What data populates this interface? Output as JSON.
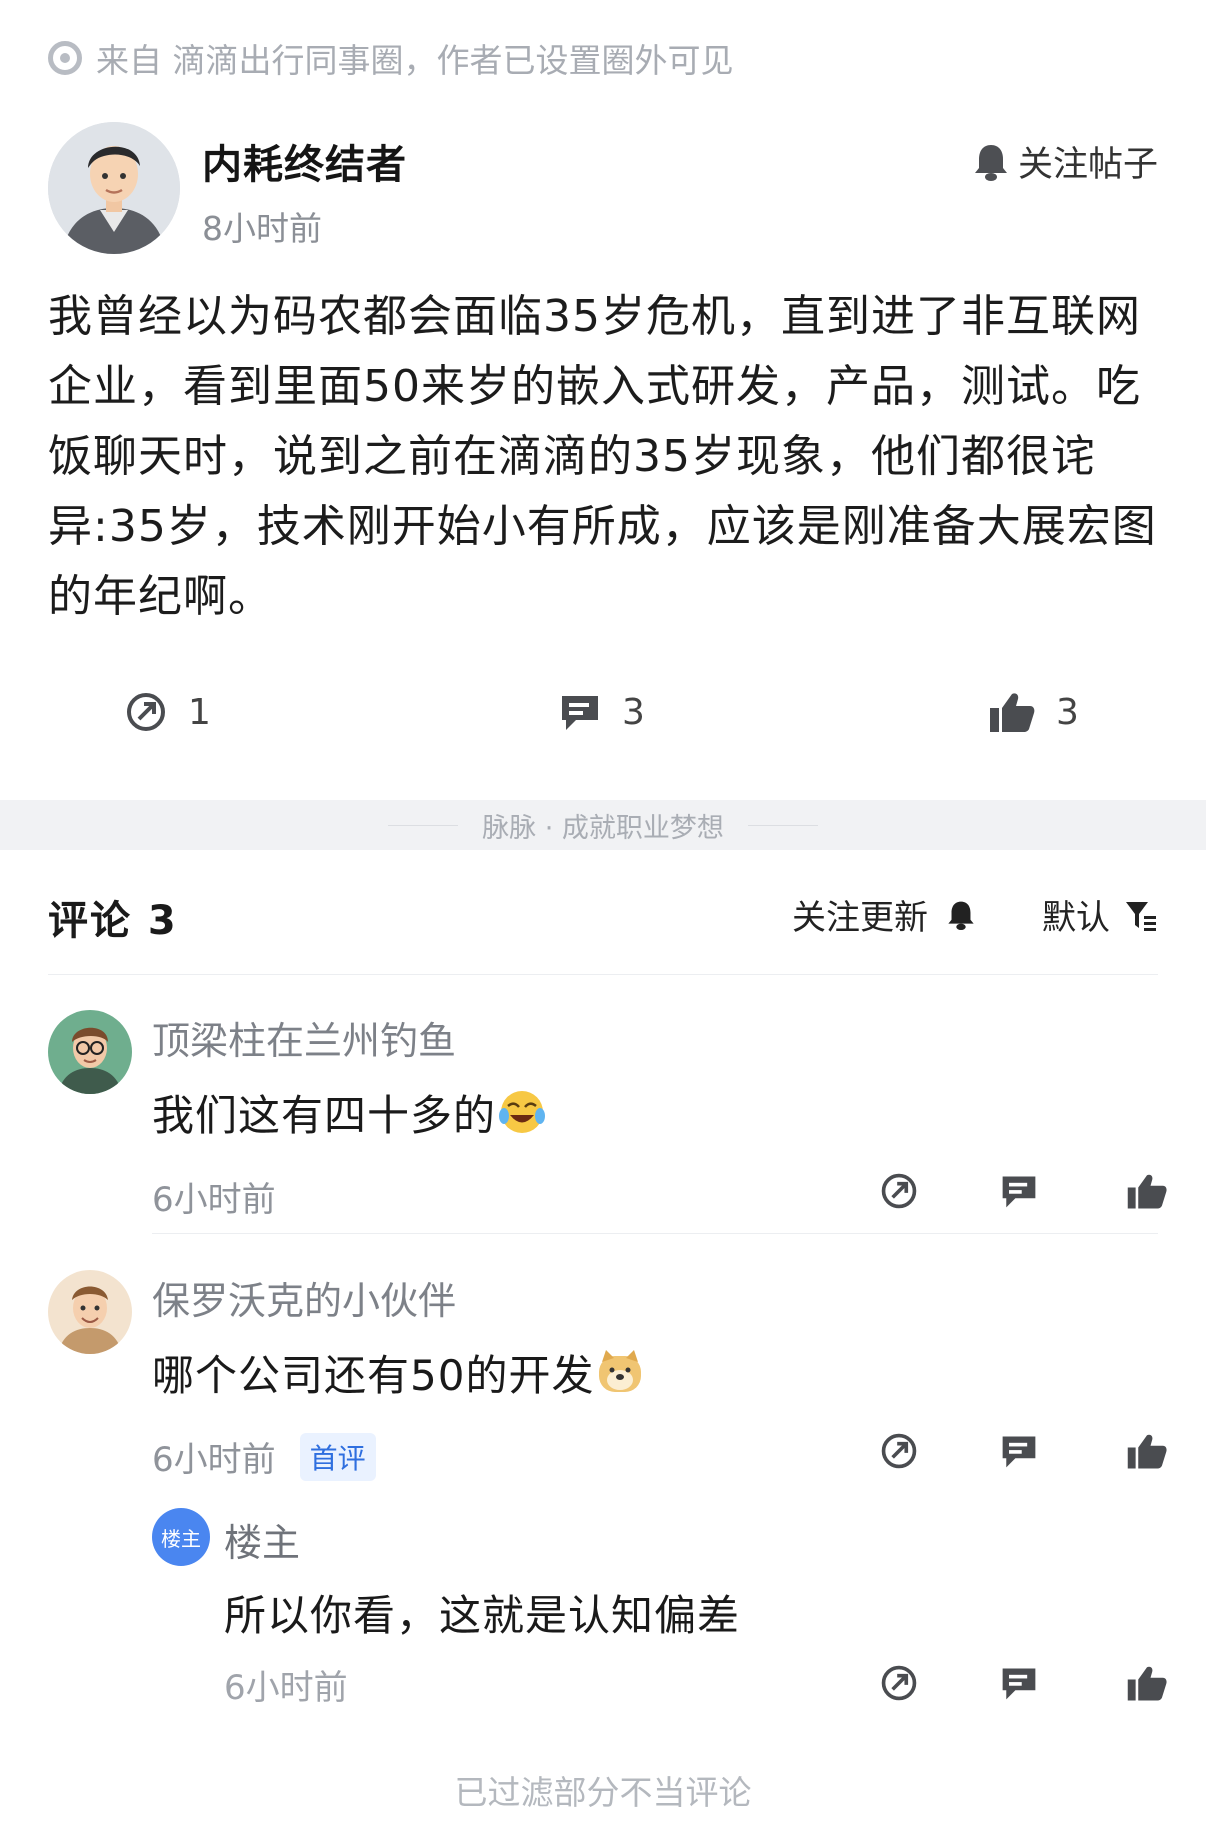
{
  "source": {
    "text": "来自 滴滴出行同事圈，作者已设置圈外可见"
  },
  "author": {
    "name": "内耗终结者",
    "time": "8小时前"
  },
  "follow_post": {
    "label": "关注帖子"
  },
  "post": {
    "body": "我曾经以为码农都会面临35岁危机，直到进了非互联网企业，看到里面50来岁的嵌入式研发，产品，测试。吃饭聊天时，说到之前在滴滴的35岁现象，他们都很诧异:35岁，技术刚开始小有所成，应该是刚准备大展宏图的年纪啊。"
  },
  "actions": {
    "share_count": "1",
    "comment_count": "3",
    "like_count": "3"
  },
  "band": {
    "text": "脉脉 · 成就职业梦想"
  },
  "comments_header": {
    "title": "评论 3",
    "follow_label": "关注更新",
    "sort_label": "默认"
  },
  "comments": [
    {
      "name": "顶梁柱在兰州钓鱼",
      "text": "我们这有四十多的",
      "emoji": "laughing-crying-emoji",
      "time": "6小时前"
    },
    {
      "name": "保罗沃克的小伙伴",
      "text": "哪个公司还有50的开发",
      "emoji": "doge-emoji",
      "time": "6小时前",
      "badge": "首评"
    }
  ],
  "reply": {
    "badge": "楼主",
    "name": "楼主",
    "text": "所以你看，这就是认知偏差",
    "time": "6小时前"
  },
  "filtered": {
    "text": "已过滤部分不当评论"
  },
  "colors": {
    "accent_blue": "#4a86f0",
    "badge_bg": "#eaf2ff",
    "muted": "#8b8f96"
  }
}
